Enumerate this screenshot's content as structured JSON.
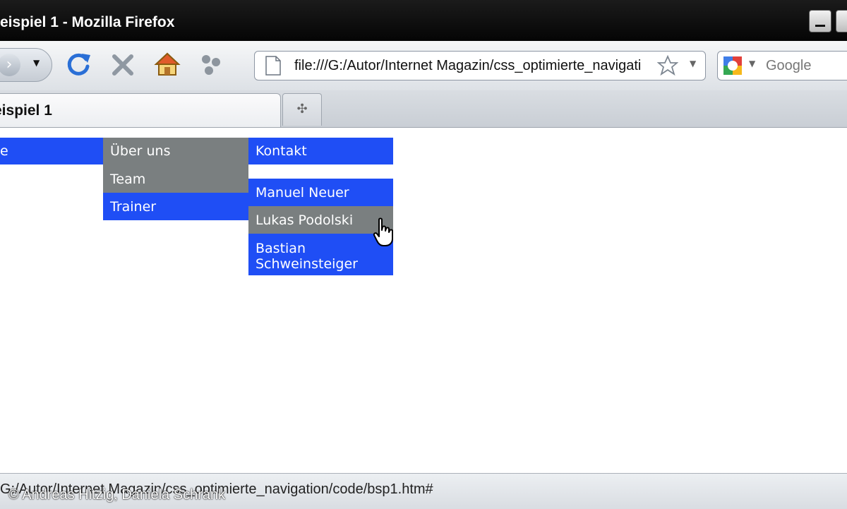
{
  "window": {
    "title": "eispiel 1 - Mozilla Firefox"
  },
  "toolbar": {
    "url": "file:///G:/Autor/Internet Magazin/css_optimierte_navigati",
    "search_placeholder": "Google"
  },
  "tabs": [
    {
      "label": "eispiel 1"
    }
  ],
  "menu": {
    "home": "e",
    "about": "Über uns",
    "team": "Team",
    "trainer": "Trainer",
    "contact": "Kontakt",
    "players": [
      "Manuel Neuer",
      "Lukas Podolski",
      "Bastian Schweinsteiger"
    ]
  },
  "status": {
    "text": "G:/Autor/Internet Magazin/css_optimierte_navigation/code/bsp1.htm#"
  },
  "credit": "© Andreas Hitzig, Daniela Schrank",
  "colors": {
    "menu_blue": "#1f4ef5",
    "menu_gray": "#7a7f80"
  }
}
